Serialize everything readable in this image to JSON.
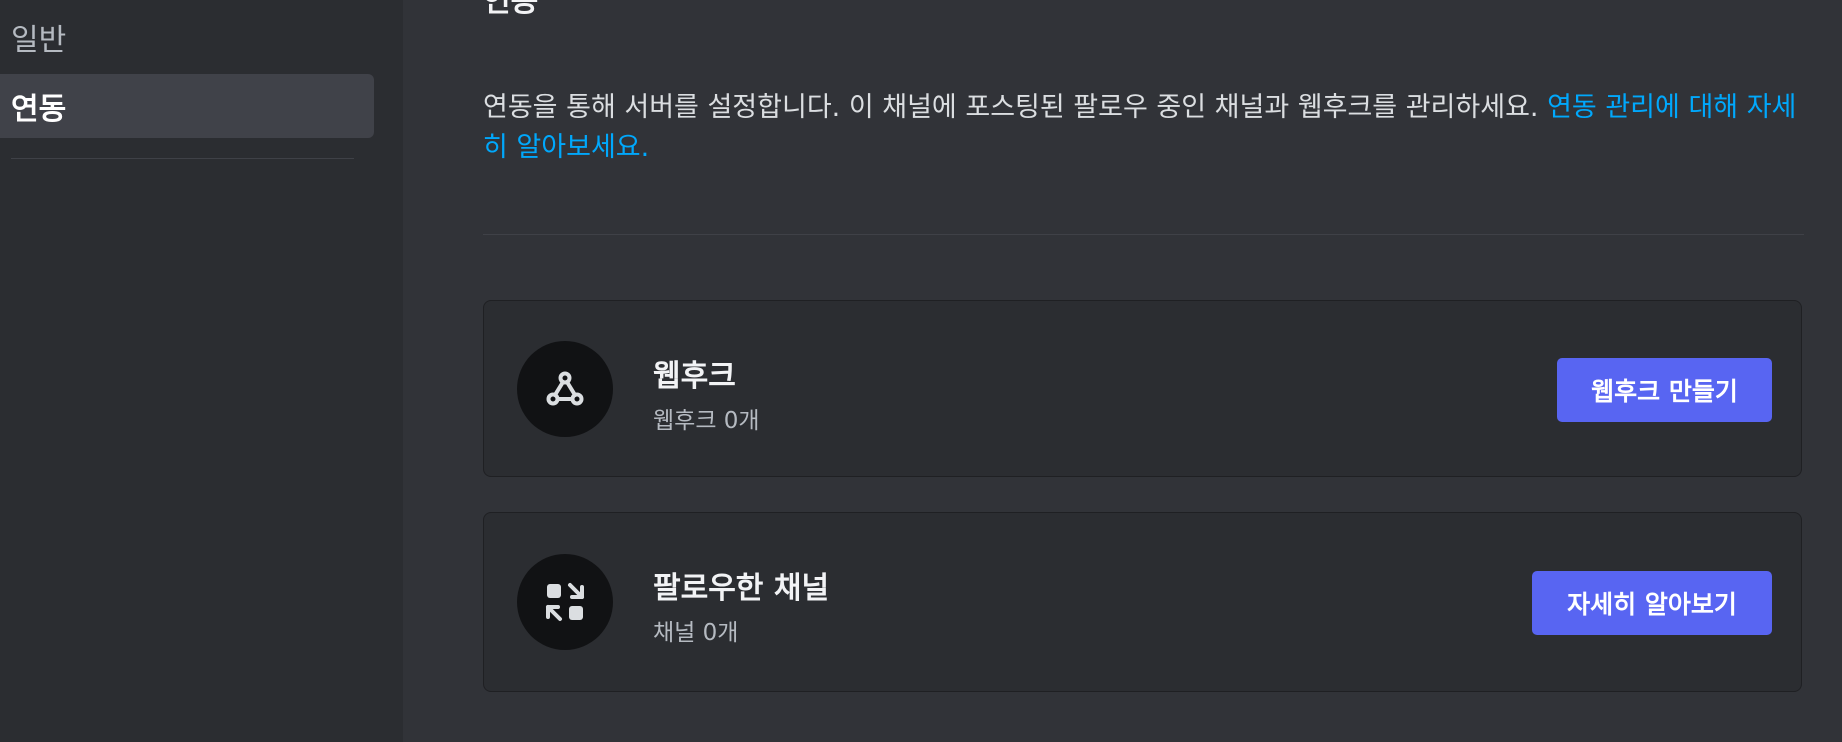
{
  "sidebar": {
    "items": [
      {
        "label": "일반"
      },
      {
        "label": "연동"
      }
    ]
  },
  "main": {
    "description": "연동을 통해 서버를 설정합니다. 이 채널에 포스팅된 팔로우 중인 채널과 웹후크를 관리하세요. ",
    "learn_more_link": "연동 관리에 대해 자세히 알아보세요.",
    "cards": [
      {
        "title": "웹후크",
        "subtitle": "웹후크 0개",
        "button": "웹후크 만들기",
        "icon": "webhook-icon"
      },
      {
        "title": "팔로우한 채널",
        "subtitle": "채널 0개",
        "button": "자세히 알아보기",
        "icon": "follow-channel-icon"
      }
    ]
  },
  "colors": {
    "accent": "#5865f2",
    "link": "#00a8fc",
    "background": "#313338",
    "sidebar": "#2b2d31"
  }
}
